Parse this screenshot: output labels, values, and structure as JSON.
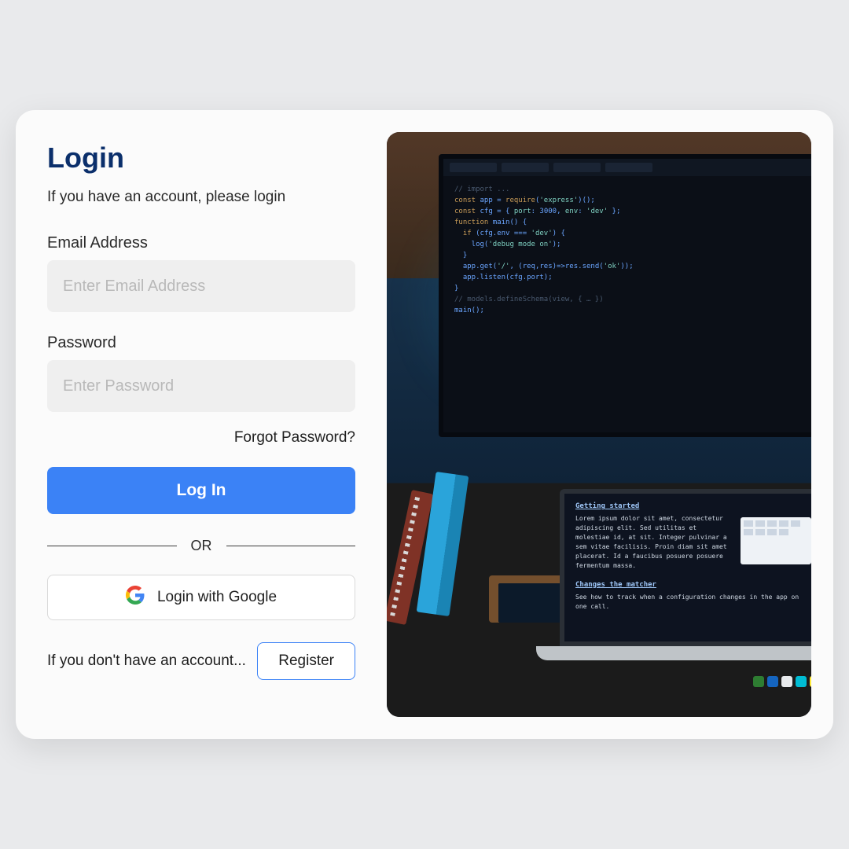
{
  "header": {
    "title": "Login",
    "subtitle": "If you have an account, please login"
  },
  "fields": {
    "email": {
      "label": "Email Address",
      "placeholder": "Enter Email Address"
    },
    "password": {
      "label": "Password",
      "placeholder": "Enter Password"
    }
  },
  "actions": {
    "forgot": "Forgot Password?",
    "login": "Log In",
    "divider": "OR",
    "google": "Login with Google",
    "register_prompt": "If you don't have an account...",
    "register": "Register"
  }
}
